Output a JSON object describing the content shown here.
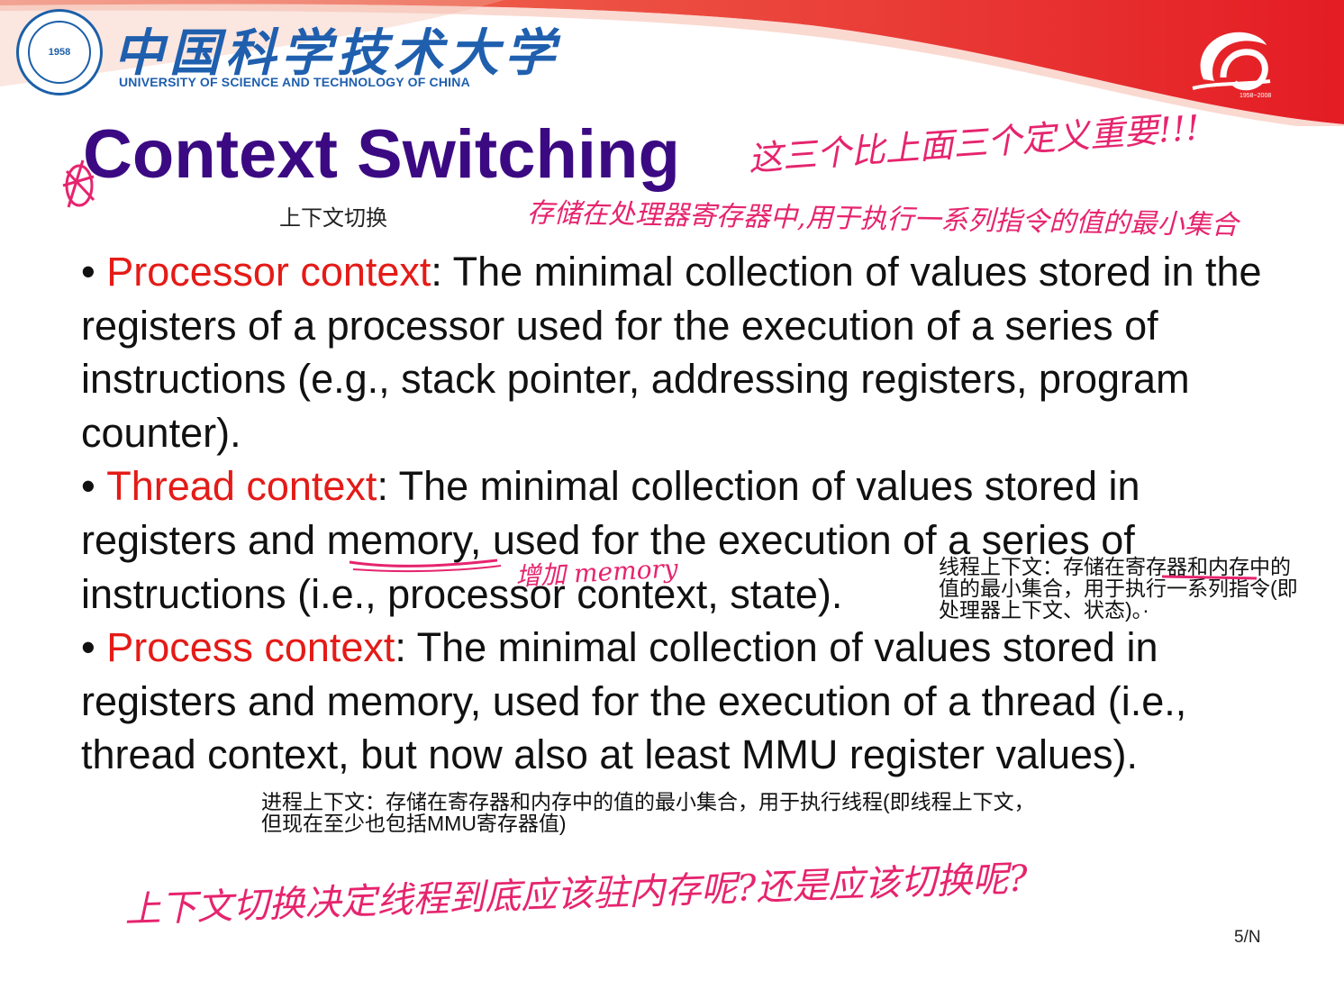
{
  "header": {
    "university_name_cn": "中国科学技术大学",
    "university_name_en": "UNIVERSITY OF SCIENCE AND TECHNOLOGY OF CHINA",
    "seal_year": "1958",
    "anniversary_years": "1958~2008"
  },
  "slide": {
    "title": "Context Switching",
    "title_translation": "上下文切换",
    "bullets": [
      {
        "term": "Processor context",
        "text": ": The minimal collection of values stored in the registers of a processor used for the execution of a series of instructions (e.g., stack pointer, addressing registers, program counter)."
      },
      {
        "term": "Thread context",
        "text_before": ": The minimal collection of values stored in registers and ",
        "underlined": "memory",
        "text_after": ", used for the execution of a series of instructions (i.e., processor context, state)."
      },
      {
        "term": "Process context",
        "text": ": The minimal collection of values stored in registers and memory, used for the execution of a thread (i.e., thread context, but now also at least MMU register values)."
      }
    ],
    "page_number": "5/N"
  },
  "notes": {
    "thread_context_cn": "线程上下文：存储在寄存器和内存中的值的最小集合，用于执行一系列指令(即处理器上下文、状态)。·",
    "process_context_cn": "进程上下文：存储在寄存器和内存中的值的最小集合，用于执行线程(即线程上下文，但现在至少也包括MMU寄存器值)"
  },
  "handwriting": {
    "top_right": "这三个比上面三个定义重要!!!",
    "under_title": "存储在处理器寄存器中,用于执行一系列指令的值的最小集合",
    "memory_note": "增加 memory",
    "bottom": "上下文切换决定线程到底应该驻内存呢?还是应该切换呢?"
  },
  "colors": {
    "title": "#3b0a82",
    "term": "#e41b17",
    "handwriting": "#e6246e",
    "brand_blue": "#1f5fae",
    "band_red": "#e8262b"
  }
}
